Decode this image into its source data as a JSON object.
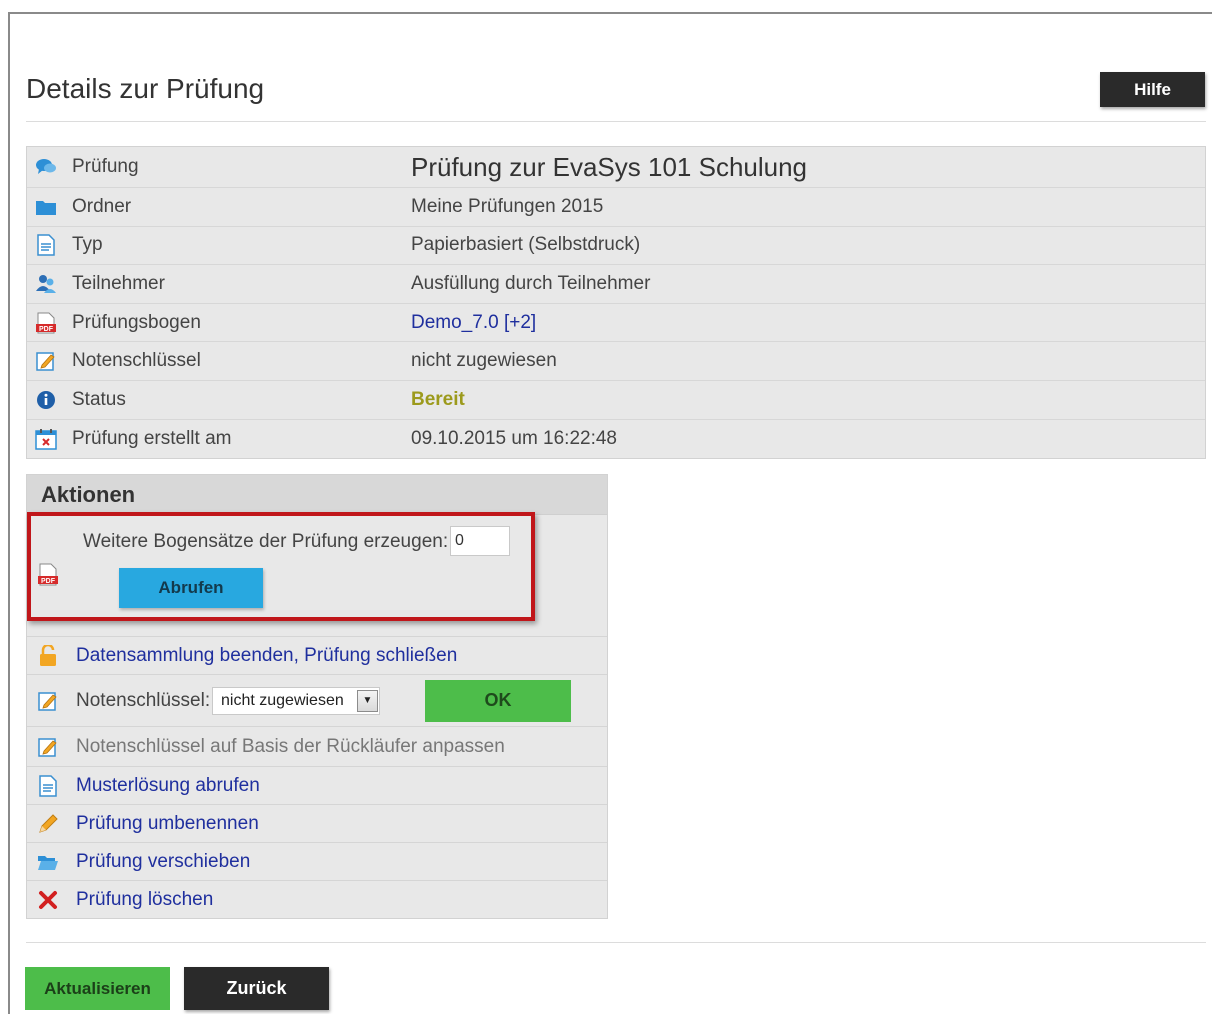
{
  "page": {
    "title": "Details zur Prüfung",
    "help_label": "Hilfe"
  },
  "details": [
    {
      "icon": "speech-bubbles-icon",
      "label": "Prüfung",
      "value": "Prüfung zur EvaSys 101 Schulung"
    },
    {
      "icon": "folder-icon",
      "label": "Ordner",
      "value": "Meine Prüfungen 2015"
    },
    {
      "icon": "document-icon",
      "label": "Typ",
      "value": "Papierbasiert (Selbstdruck)"
    },
    {
      "icon": "users-icon",
      "label": "Teilnehmer",
      "value": "Ausfüllung durch Teilnehmer"
    },
    {
      "icon": "pdf-icon",
      "label": "Prüfungsbogen",
      "value": "Demo_7.0 [+2]"
    },
    {
      "icon": "edit-note-icon",
      "label": "Notenschlüssel",
      "value": "nicht zugewiesen"
    },
    {
      "icon": "info-icon",
      "label": "Status",
      "value": "Bereit"
    },
    {
      "icon": "calendar-icon",
      "label": "Prüfung erstellt am",
      "value": "09.10.2015 um 16:22:48"
    }
  ],
  "actions": {
    "heading": "Aktionen",
    "generate_label": "Weitere Bogensätze der Prüfung erzeugen:",
    "generate_value": "0",
    "fetch_label": "Abrufen",
    "close_collection_label": "Datensammlung beenden, Prüfung schließen",
    "grade_key_label": "Notenschlüssel:",
    "grade_key_selected": "nicht zugewiesen",
    "ok_label": "OK",
    "adjust_grade_key_label": "Notenschlüssel auf Basis der Rückläufer anpassen",
    "sample_solution_label": "Musterlösung abrufen",
    "rename_label": "Prüfung umbenennen",
    "move_label": "Prüfung verschieben",
    "delete_label": "Prüfung löschen"
  },
  "footer": {
    "update_label": "Aktualisieren",
    "back_label": "Zurück"
  },
  "colors": {
    "link": "#1f2f9e",
    "status_ready": "#9c9a1c",
    "fetch_button": "#28a8e0",
    "green_button": "#4dbd4a",
    "dark_button": "#2a2a2a",
    "highlight_border": "#c0161a"
  }
}
